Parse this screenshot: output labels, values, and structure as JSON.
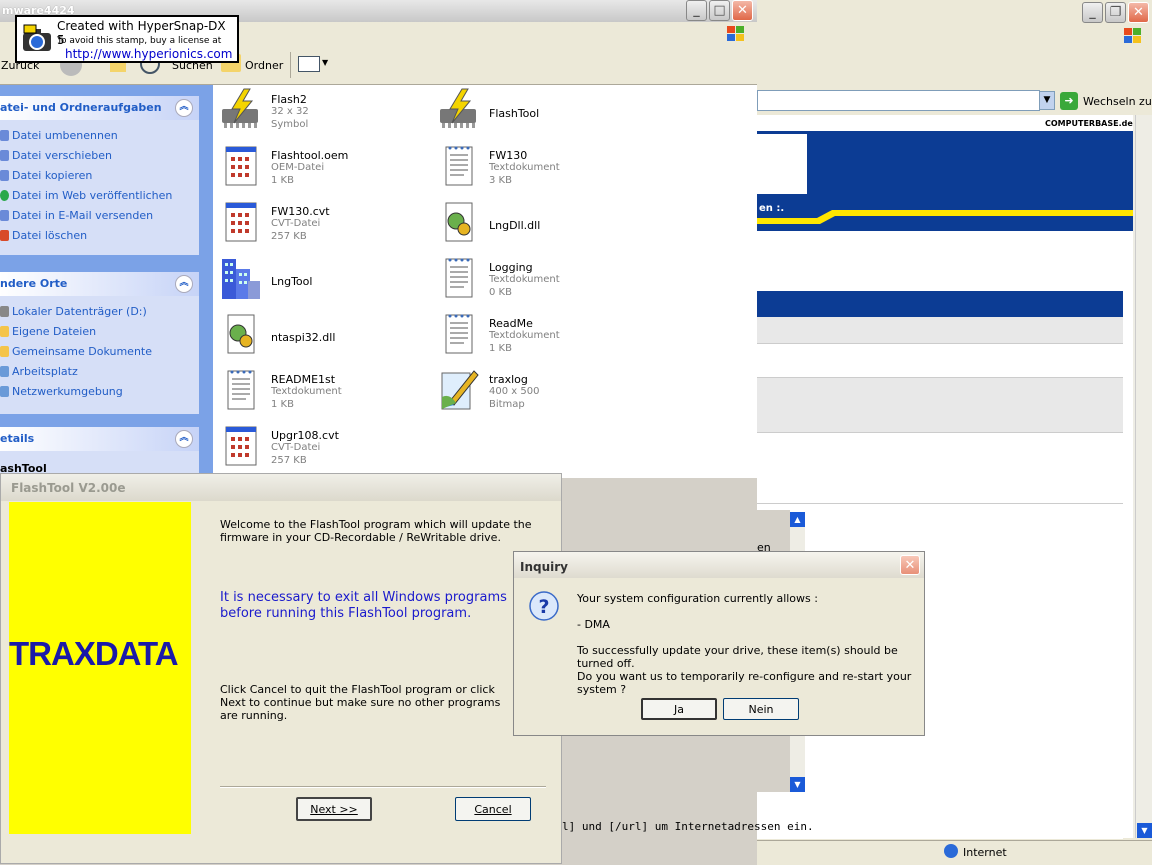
{
  "stamp": {
    "line1": "Created with HyperSnap-DX 5",
    "line2": "To avoid this stamp, buy a license at",
    "line3": "http://www.hyperionics.com"
  },
  "explorer": {
    "title": "mware4424",
    "toolbar": {
      "back_label": "Zurück",
      "search_label": "Suchen",
      "folders_label": "Ordner"
    },
    "panels": {
      "tasks": {
        "header": "atei- und Ordneraufgaben",
        "items": [
          "Datei umbenennen",
          "Datei verschieben",
          "Datei kopieren",
          "Datei im Web veröffentlichen",
          "Datei in E-Mail versenden",
          "Datei löschen"
        ]
      },
      "places": {
        "header": "ndere Orte",
        "items": [
          "Lokaler Datenträger (D:)",
          "Eigene Dateien",
          "Gemeinsame Dokumente",
          "Arbeitsplatz",
          "Netzwerkumgebung"
        ]
      },
      "details": {
        "header": "etails",
        "item": "ashTool"
      }
    },
    "files": [
      {
        "name": "Flash2",
        "l1": "32 x 32",
        "l2": "Symbol",
        "icon": "flash-chip-icon"
      },
      {
        "name": "FlashTool",
        "l1": "",
        "l2": "",
        "icon": "flash-chip-icon"
      },
      {
        "name": "Flashtool.oem",
        "l1": "OEM-Datei",
        "l2": "1 KB",
        "icon": "oem-file-icon"
      },
      {
        "name": "FW130",
        "l1": "Textdokument",
        "l2": "3 KB",
        "icon": "text-document-icon"
      },
      {
        "name": "FW130.cvt",
        "l1": "CVT-Datei",
        "l2": "257 KB",
        "icon": "cvt-file-icon"
      },
      {
        "name": "LngDll.dll",
        "l1": "",
        "l2": "",
        "icon": "dll-file-icon"
      },
      {
        "name": "LngTool",
        "l1": "",
        "l2": "",
        "icon": "building-app-icon"
      },
      {
        "name": "Logging",
        "l1": "Textdokument",
        "l2": "0 KB",
        "icon": "text-document-icon"
      },
      {
        "name": "ntaspi32.dll",
        "l1": "",
        "l2": "",
        "icon": "dll-file-icon"
      },
      {
        "name": "ReadMe",
        "l1": "Textdokument",
        "l2": "1 KB",
        "icon": "text-document-icon"
      },
      {
        "name": "README1st",
        "l1": "Textdokument",
        "l2": "1 KB",
        "icon": "text-document-icon"
      },
      {
        "name": "traxlog",
        "l1": "400 x 500",
        "l2": "Bitmap",
        "icon": "bitmap-file-icon"
      },
      {
        "name": "Upgr108.cvt",
        "l1": "CVT-Datei",
        "l2": "257 KB",
        "icon": "cvt-file-icon"
      }
    ]
  },
  "browser": {
    "go_label": "Wechseln zu",
    "site_logo": "COMPUTERBASE.de",
    "banner_text": "en :.",
    "partial_text": "en",
    "bottom_text": "l] und [/url] um Internetadressen ein.",
    "status_zone": "Internet"
  },
  "flashtool": {
    "title": "FlashTool V2.00e",
    "logo": "TRAXDATA",
    "welcome": "Welcome to the FlashTool program which will update the firmware in your CD-Recordable / ReWritable drive.",
    "warning": "It is necessary to exit all Windows programs before running this FlashTool program.",
    "instructions": "Click Cancel to quit the FlashTool program or click Next to continue but make sure no other programs are running.",
    "next_label": "Next >>",
    "cancel_label": "Cancel"
  },
  "inquiry": {
    "title": "Inquiry",
    "line1": "Your system configuration currently allows :",
    "line2": "- DMA",
    "line3": "To successfully update your drive, these item(s) should be turned off.",
    "line4": "Do you want us to temporarily re-configure and re-start your system ?",
    "yes_label": "Ja",
    "no_label": "Nein"
  },
  "colors": {
    "xp_blue": "#215dc6",
    "traxdata_yellow": "#ffff00",
    "traxdata_blue": "#1a1aa8",
    "computerbase_blue": "#0c3c94"
  }
}
